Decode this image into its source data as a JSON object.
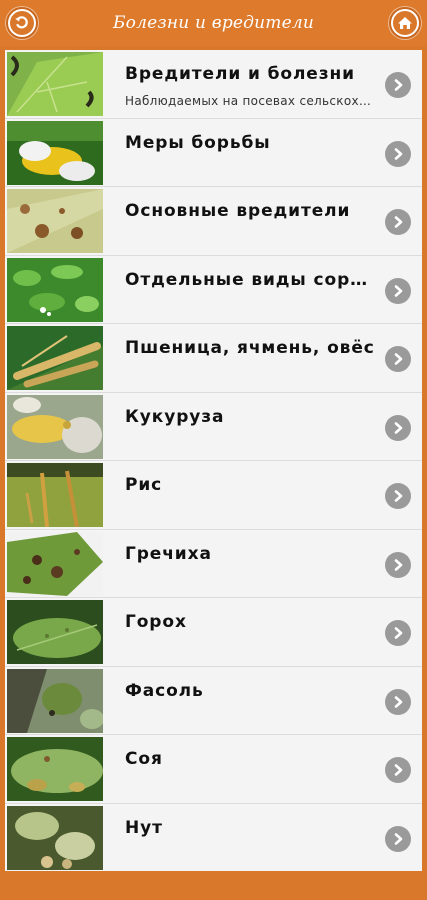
{
  "header": {
    "title": "Болезни и вредители",
    "back_icon": "back-arrow-icon",
    "home_icon": "home-icon"
  },
  "colors": {
    "accent": "#dd7a2c",
    "chevron": "#9a9a9a",
    "list_bg": "#f4f4f4"
  },
  "items": [
    {
      "title": "Вредители и болезни",
      "subtitle": "Наблюдаемых на посевах сельскохозяйственных культур",
      "thumb": "leaf-pests"
    },
    {
      "title": "Меры борьбы",
      "subtitle": "",
      "thumb": "gloved-hands-corn"
    },
    {
      "title": "Основные вредители",
      "subtitle": "",
      "thumb": "spotted-leaf"
    },
    {
      "title": "Отдельные виды сорняков",
      "subtitle": "",
      "thumb": "weeds"
    },
    {
      "title": "Пшеница, ячмень, овёс",
      "subtitle": "",
      "thumb": "wheat-ears"
    },
    {
      "title": "Кукуруза",
      "subtitle": "",
      "thumb": "corn-cob"
    },
    {
      "title": "Рис",
      "subtitle": "",
      "thumb": "rice-panicle"
    },
    {
      "title": "Гречиха",
      "subtitle": "",
      "thumb": "buckwheat-leaf"
    },
    {
      "title": "Горох",
      "subtitle": "",
      "thumb": "pea-leaf"
    },
    {
      "title": "Фасоль",
      "subtitle": "",
      "thumb": "bean-plant"
    },
    {
      "title": "Соя",
      "subtitle": "",
      "thumb": "soy-leaf"
    },
    {
      "title": "Нут",
      "subtitle": "",
      "thumb": "chickpea"
    }
  ]
}
